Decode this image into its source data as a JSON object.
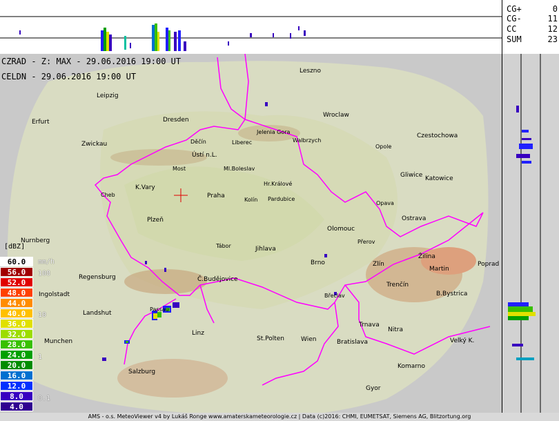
{
  "stats": [
    {
      "label": "CG+",
      "value": "0"
    },
    {
      "label": "CG-",
      "value": "11"
    },
    {
      "label": "CC",
      "value": "12"
    },
    {
      "label": "SUM",
      "value": "23"
    }
  ],
  "titles": {
    "radar": "CZRAD - Z: MAX - 29.06.2016 19:00 UT",
    "lightning": "CELDN - 29.06.2016 19:00 UT"
  },
  "legend": {
    "title": "[dBZ]",
    "rate_unit": "mm/h",
    "levels": [
      {
        "label": "60.0",
        "color": "#ffffff",
        "text": "#000000"
      },
      {
        "label": "56.0",
        "color": "#a00000",
        "text": "#ffffff"
      },
      {
        "label": "52.0",
        "color": "#e00000",
        "text": "#ffffff"
      },
      {
        "label": "48.0",
        "color": "#ff4000",
        "text": "#ffffff"
      },
      {
        "label": "44.0",
        "color": "#ff8c00",
        "text": "#ffffff"
      },
      {
        "label": "40.0",
        "color": "#ffc000",
        "text": "#ffffff"
      },
      {
        "label": "36.0",
        "color": "#e0e000",
        "text": "#ffffff"
      },
      {
        "label": "32.0",
        "color": "#9cdc00",
        "text": "#ffffff"
      },
      {
        "label": "28.0",
        "color": "#38c000",
        "text": "#ffffff"
      },
      {
        "label": "24.0",
        "color": "#00a000",
        "text": "#ffffff"
      },
      {
        "label": "20.0",
        "color": "#008c00",
        "text": "#ffffff"
      },
      {
        "label": "16.0",
        "color": "#0070d0",
        "text": "#ffffff"
      },
      {
        "label": "12.0",
        "color": "#0030ff",
        "text": "#ffffff"
      },
      {
        "label": "8.0",
        "color": "#3800c0",
        "text": "#ffffff"
      },
      {
        "label": "4.0",
        "color": "#300090",
        "text": "#ffffff"
      }
    ],
    "rates": [
      "108",
      "10",
      "1",
      "0.1"
    ]
  },
  "cities": [
    {
      "name": "Leszno"
    },
    {
      "name": "Leipzig"
    },
    {
      "name": "Erfurt"
    },
    {
      "name": "Dresden"
    },
    {
      "name": "Wroclaw"
    },
    {
      "name": "Jelenia Gora"
    },
    {
      "name": "Czestochowa"
    },
    {
      "name": "Zwickau"
    },
    {
      "name": "Děčín"
    },
    {
      "name": "Liberec"
    },
    {
      "name": "Walbrzych"
    },
    {
      "name": "Opole"
    },
    {
      "name": "Ústí n.L."
    },
    {
      "name": "Most"
    },
    {
      "name": "Ml.Boleslav"
    },
    {
      "name": "Gliwice"
    },
    {
      "name": "Katowice"
    },
    {
      "name": "K.Vary"
    },
    {
      "name": "Hr.Králové"
    },
    {
      "name": "Cheb"
    },
    {
      "name": "Praha"
    },
    {
      "name": "Kolín"
    },
    {
      "name": "Pardubice"
    },
    {
      "name": "Opava"
    },
    {
      "name": "Ostrava"
    },
    {
      "name": "Plzeň"
    },
    {
      "name": "Olomouc"
    },
    {
      "name": "Přerov"
    },
    {
      "name": "Nurnberg"
    },
    {
      "name": "Tábor"
    },
    {
      "name": "Jihlava"
    },
    {
      "name": "Žilina"
    },
    {
      "name": "Brno"
    },
    {
      "name": "Zlín"
    },
    {
      "name": "Martin"
    },
    {
      "name": "Poprad"
    },
    {
      "name": "Regensburg"
    },
    {
      "name": "Č.Budějovice"
    },
    {
      "name": "Trenčín"
    },
    {
      "name": "Ingolstadt"
    },
    {
      "name": "Břeclav"
    },
    {
      "name": "B.Bystrica"
    },
    {
      "name": "Passau"
    },
    {
      "name": "Landshut"
    },
    {
      "name": "Trnava"
    },
    {
      "name": "Linz"
    },
    {
      "name": "Nitra"
    },
    {
      "name": "Munchen"
    },
    {
      "name": "St.Polten"
    },
    {
      "name": "Wien"
    },
    {
      "name": "Bratislava"
    },
    {
      "name": "Velký K."
    },
    {
      "name": "Komarno"
    },
    {
      "name": "Salzburg"
    },
    {
      "name": "Gyor"
    }
  ],
  "footer": "AMS - o.s. MeteoViewer v4 by Lukáš Ronge www.amaterskameteorologie.cz | Data (c)2016: CHMI, EUMETSAT, Siemens AG, Blitzortung.org",
  "colors": {
    "border": "#ff00ff",
    "background": "#c9c9c9",
    "coverage": "#d8dcc0"
  }
}
